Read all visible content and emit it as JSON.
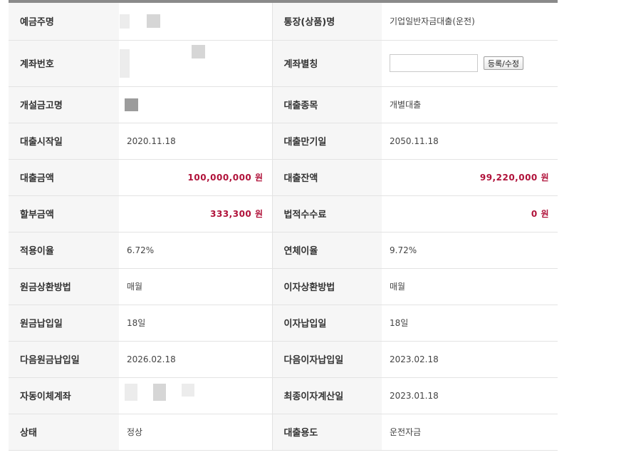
{
  "rows": [
    {
      "l1": "예금주명",
      "v1": "",
      "l2": "통장(상품)명",
      "v2": "기업일반자금대출(운전)"
    },
    {
      "l1": "계좌번호",
      "v1": "",
      "l2": "계좌별칭",
      "v2": ""
    },
    {
      "l1": "개설금고명",
      "v1": "",
      "l2": "대출종목",
      "v2": "개별대출"
    },
    {
      "l1": "대출시작일",
      "v1": "2020.11.18",
      "l2": "대출만기일",
      "v2": "2050.11.18"
    },
    {
      "l1": "대출금액",
      "v1": "100,000,000 원",
      "l2": "대출잔액",
      "v2": "99,220,000 원"
    },
    {
      "l1": "할부금액",
      "v1": "333,300 원",
      "l2": "법적수수료",
      "v2": "0 원"
    },
    {
      "l1": "적용이율",
      "v1": "6.72%",
      "l2": "연체이율",
      "v2": "9.72%"
    },
    {
      "l1": "원금상환방법",
      "v1": "매월",
      "l2": "이자상환방법",
      "v2": "매월"
    },
    {
      "l1": "원금납입일",
      "v1": "18일",
      "l2": "이자납입일",
      "v2": "18일"
    },
    {
      "l1": "다음원금납입일",
      "v1": "2026.02.18",
      "l2": "다음이자납입일",
      "v2": "2023.02.18"
    },
    {
      "l1": "자동이체계좌",
      "v1": "",
      "l2": "최종이자계산일",
      "v2": "2023.01.18"
    },
    {
      "l1": "상태",
      "v1": "정상",
      "l2": "대출용도",
      "v2": "운전자금"
    }
  ],
  "alias_button_label": "등록/수정",
  "alias_input_value": "",
  "colors": {
    "amount": "#b0123a",
    "header_bg": "#f6f6f6",
    "border": "#e3e3e3"
  }
}
